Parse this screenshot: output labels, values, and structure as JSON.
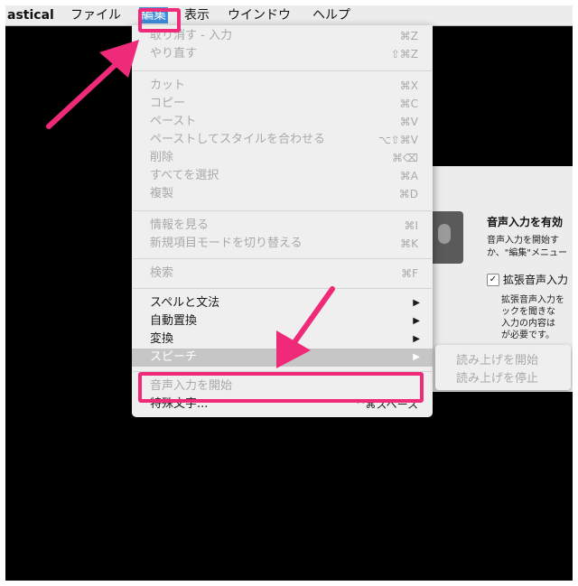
{
  "menubar": {
    "app": "astical",
    "items": [
      "ファイル",
      "編集",
      "表示",
      "ウインドウ",
      "ヘルプ"
    ]
  },
  "edit_menu": {
    "groups": [
      [
        {
          "label": "取り消す - 入力",
          "shortcut": "⌘Z",
          "enabled": false
        },
        {
          "label": "やり直す",
          "shortcut": "⇧⌘Z",
          "enabled": false
        }
      ],
      [
        {
          "label": "カット",
          "shortcut": "⌘X",
          "enabled": false
        },
        {
          "label": "コピー",
          "shortcut": "⌘C",
          "enabled": false
        },
        {
          "label": "ペースト",
          "shortcut": "⌘V",
          "enabled": false
        },
        {
          "label": "ペーストしてスタイルを合わせる",
          "shortcut": "⌥⇧⌘V",
          "enabled": false
        },
        {
          "label": "削除",
          "shortcut": "⌘⌫",
          "enabled": false
        },
        {
          "label": "すべてを選択",
          "shortcut": "⌘A",
          "enabled": false
        },
        {
          "label": "複製",
          "shortcut": "⌘D",
          "enabled": false
        }
      ],
      [
        {
          "label": "情報を見る",
          "shortcut": "⌘I",
          "enabled": false
        },
        {
          "label": "新規項目モードを切り替える",
          "shortcut": "⌘K",
          "enabled": false
        }
      ],
      [
        {
          "label": "検索",
          "shortcut": "⌘F",
          "enabled": false
        }
      ],
      [
        {
          "label": "スペルと文法",
          "submenu": true,
          "enabled": true
        },
        {
          "label": "自動置換",
          "submenu": true,
          "enabled": true
        },
        {
          "label": "変換",
          "submenu": true,
          "enabled": true
        },
        {
          "label": "スピーチ",
          "submenu": true,
          "enabled": true,
          "highlighted": true
        }
      ],
      [
        {
          "label": "音声入力を開始",
          "enabled": false
        },
        {
          "label": "特殊文字...",
          "shortcut": "^⌘スペース",
          "enabled": true
        }
      ]
    ]
  },
  "speech_submenu": {
    "items": [
      "読み上げを開始",
      "読み上げを停止"
    ]
  },
  "prefs_panel": {
    "title": "音声入力を有効",
    "desc_lines": [
      "音声入力を開始す",
      "か、\"編集\"メニュー"
    ],
    "checkbox_label": "拡張音声入力",
    "checkbox_checked": "✓",
    "sub_lines": [
      "拡張音声入力を",
      "ックを聞きな",
      "入力の内容は",
      "が必要です。"
    ]
  },
  "colors": {
    "highlight": "#ef2a78",
    "menu_bg": "#efefef",
    "selected": "#3d8bd9"
  }
}
